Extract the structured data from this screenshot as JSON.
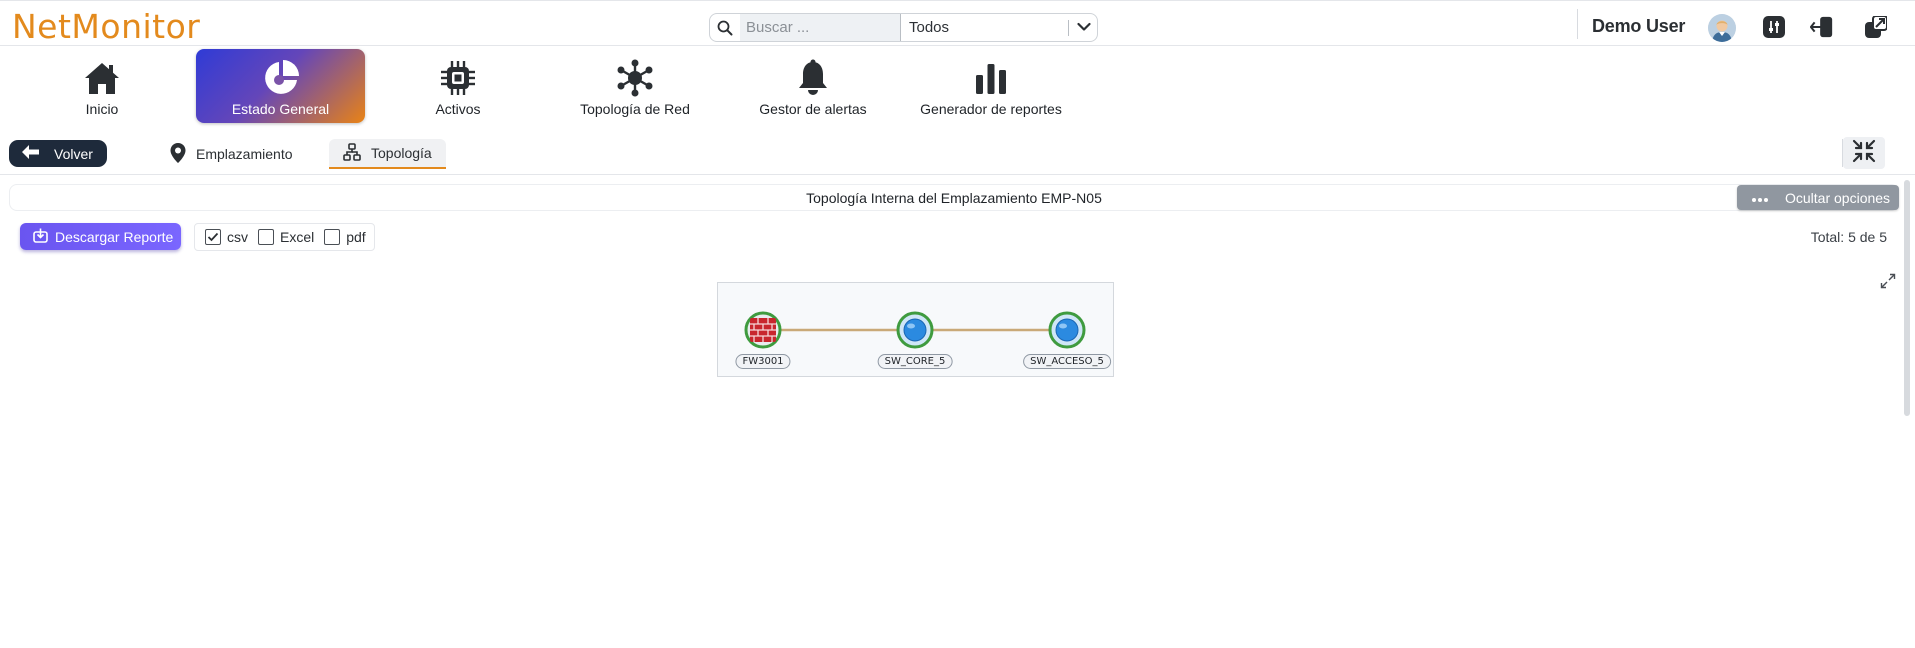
{
  "app": {
    "logo": "NetMonitor",
    "brand_color": "#e38a1d"
  },
  "search": {
    "placeholder": "Buscar ...",
    "value": "",
    "filter_selected": "Todos"
  },
  "user": {
    "name": "Demo User"
  },
  "top_icons": [
    "avatar-icon",
    "sliders-icon",
    "logout-icon",
    "external-window-icon"
  ],
  "nav": {
    "items": [
      {
        "label": "Inicio",
        "icon": "home-icon"
      },
      {
        "label": "Estado General",
        "icon": "pie-chart-icon",
        "active": true
      },
      {
        "label": "Activos",
        "icon": "chip-icon"
      },
      {
        "label": "Topología de Red",
        "icon": "network-hub-icon"
      },
      {
        "label": "Gestor de alertas",
        "icon": "bell-icon"
      },
      {
        "label": "Generador de reportes",
        "icon": "bar-chart-icon"
      }
    ]
  },
  "subbar": {
    "back_label": "Volver",
    "tabs": [
      {
        "label": "Emplazamiento",
        "icon": "map-pin-icon"
      },
      {
        "label": "Topología",
        "icon": "sitemap-icon",
        "active": true
      }
    ]
  },
  "panel": {
    "title": "Topología Interna del Emplazamiento EMP-N05",
    "hide_options_label": "Ocultar opciones"
  },
  "report": {
    "download_label": "Descargar Reporte",
    "formats": [
      {
        "label": "csv",
        "checked": true
      },
      {
        "label": "Excel",
        "checked": false
      },
      {
        "label": "pdf",
        "checked": false
      }
    ],
    "total_label": "Total: 5 de 5"
  },
  "topology": {
    "nodes": [
      {
        "id": "FW3001",
        "label": "FW3001",
        "type": "firewall"
      },
      {
        "id": "SW_CORE_5",
        "label": "SW_CORE_5",
        "type": "switch"
      },
      {
        "id": "SW_ACCESO_5",
        "label": "SW_ACCESO_5",
        "type": "switch"
      }
    ],
    "links": [
      {
        "from": "FW3001",
        "to": "SW_CORE_5"
      },
      {
        "from": "SW_CORE_5",
        "to": "SW_ACCESO_5"
      }
    ],
    "link_color": "#c9a978",
    "node_ring_color": "#3f9b3f"
  }
}
